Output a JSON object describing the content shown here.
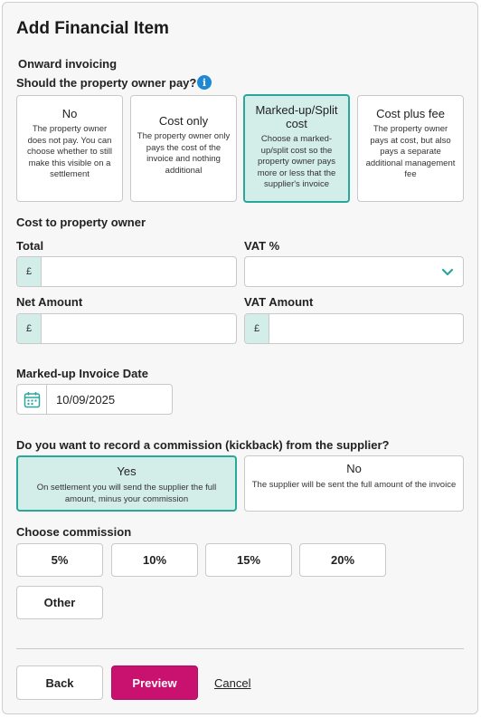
{
  "page": {
    "title": "Add Financial Item"
  },
  "invoicing": {
    "section_label": "Onward invoicing",
    "question": "Should the property owner pay?",
    "info_icon": "i",
    "options": [
      {
        "title": "No",
        "description": "The property owner does not pay. You can choose whether to still make this visible on a settlement",
        "selected": false
      },
      {
        "title": "Cost only",
        "description": "The property owner only pays the cost of the invoice and nothing additional",
        "selected": false
      },
      {
        "title": "Marked-up/Split cost",
        "description": "Choose a marked-up/split cost so the property owner pays more or less that the supplier's invoice",
        "selected": true
      },
      {
        "title": "Cost plus fee",
        "description": "The property owner pays at cost, but also pays a separate additional management fee",
        "selected": false
      }
    ]
  },
  "cost": {
    "section_label": "Cost to property owner",
    "total": {
      "label": "Total",
      "prefix": "£",
      "value": ""
    },
    "vat_percent": {
      "label": "VAT %",
      "value": ""
    },
    "net_amount": {
      "label": "Net Amount",
      "prefix": "£",
      "value": ""
    },
    "vat_amount": {
      "label": "VAT Amount",
      "prefix": "£",
      "value": ""
    },
    "invoice_date": {
      "label": "Marked-up Invoice Date",
      "value": "10/09/2025"
    }
  },
  "commission": {
    "question": "Do you want to record a commission (kickback) from the supplier?",
    "yes": {
      "title": "Yes",
      "description": "On settlement you will send the supplier the full amount, minus your commission",
      "selected": true
    },
    "no": {
      "title": "No",
      "description": "The supplier will be sent the full amount of the invoice",
      "selected": false
    },
    "choose_label": "Choose commission",
    "options": [
      "5%",
      "10%",
      "15%",
      "20%"
    ],
    "other_label": "Other"
  },
  "footer": {
    "back_label": "Back",
    "preview_label": "Preview",
    "cancel_label": "Cancel"
  },
  "colors": {
    "accent": "#2aa79b",
    "accent_bg": "#d3ede9",
    "primary": "#c9126f",
    "info": "#1e88d2"
  },
  "icons": {
    "info": "info-icon",
    "calendar": "calendar-icon",
    "dropdown": "chevron-down-icon"
  }
}
